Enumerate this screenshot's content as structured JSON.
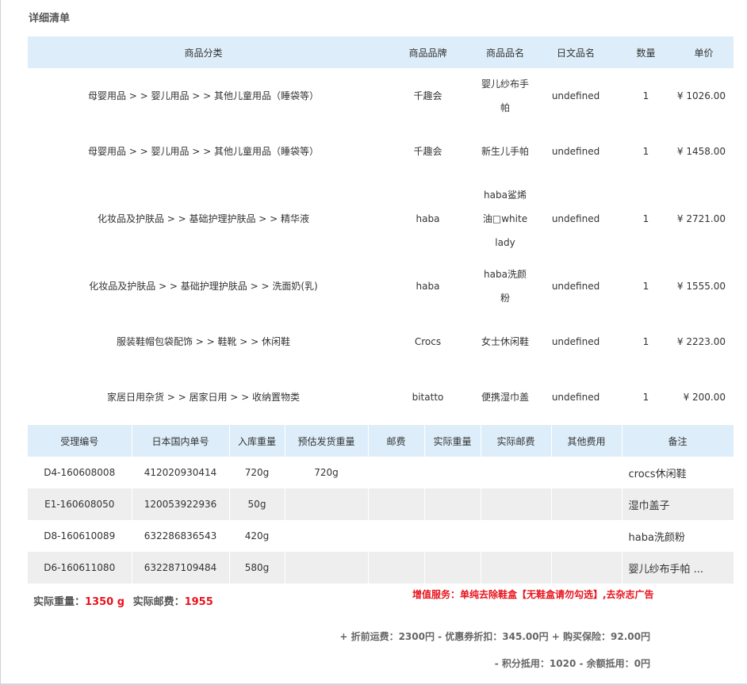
{
  "section_title": "详细清单",
  "detail_table": {
    "headers": [
      "商品分类",
      "商品品牌",
      "商品品名",
      "日文品名",
      "数量",
      "单价"
    ],
    "rows": [
      {
        "category": "母婴用品 > > 婴儿用品 > > 其他儿童用品（睡袋等）",
        "brand": "千趣会",
        "name": "婴儿纱布手帕",
        "jp_name": "undefined",
        "qty": "1",
        "price": "¥ 1026.00"
      },
      {
        "category": "母婴用品 > > 婴儿用品 > > 其他儿童用品（睡袋等）",
        "brand": "千趣会",
        "name": "新生儿手帕",
        "jp_name": "undefined",
        "qty": "1",
        "price": "¥ 1458.00"
      },
      {
        "category": "化妆品及护肤品 > > 基础护理护肤品 > > 精华液",
        "brand": "haba",
        "name": "haba鲨烯油□white lady",
        "jp_name": "undefined",
        "qty": "1",
        "price": "¥ 2721.00"
      },
      {
        "category": "化妆品及护肤品 > > 基础护理护肤品 > > 洗面奶(乳)",
        "brand": "haba",
        "name": "haba洗颜粉",
        "jp_name": "undefined",
        "qty": "1",
        "price": "¥ 1555.00"
      },
      {
        "category": "服装鞋帽包袋配饰 > > 鞋靴 > > 休闲鞋",
        "brand": "Crocs",
        "name": "女士休闲鞋",
        "jp_name": "undefined",
        "qty": "1",
        "price": "¥ 2223.00"
      },
      {
        "category": "家居日用杂货 > > 居家日用 > > 收纳置物类",
        "brand": "bitatto",
        "name": "便携湿巾盖",
        "jp_name": "undefined",
        "qty": "1",
        "price": "¥ 200.00"
      }
    ]
  },
  "receive_table": {
    "headers": [
      "受理编号",
      "日本国内单号",
      "入库重量",
      "预估发货重量",
      "邮费",
      "实际重量",
      "实际邮费",
      "其他费用",
      "备注"
    ],
    "rows": [
      {
        "id": "D4-160608008",
        "jp_no": "412020930414",
        "in_weight": "720g",
        "est_weight": "720g",
        "postage": "",
        "real_weight": "",
        "real_postage": "",
        "other": "",
        "note": "crocs休闲鞋"
      },
      {
        "id": "E1-160608050",
        "jp_no": "120053922936",
        "in_weight": "50g",
        "est_weight": "",
        "postage": "",
        "real_weight": "",
        "real_postage": "",
        "other": "",
        "note": "湿巾盖子"
      },
      {
        "id": "D8-160610089",
        "jp_no": "632286836543",
        "in_weight": "420g",
        "est_weight": "",
        "postage": "",
        "real_weight": "",
        "real_postage": "",
        "other": "",
        "note": "haba洗颜粉"
      },
      {
        "id": "D6-160611080",
        "jp_no": "632287109484",
        "in_weight": "580g",
        "est_weight": "",
        "postage": "",
        "real_weight": "",
        "real_postage": "",
        "other": "",
        "note": "婴儿纱布手帕 ..."
      }
    ]
  },
  "summary": {
    "weight_label": "实际重量：",
    "weight_value": "1350 g",
    "postage_label": "实际邮费：",
    "postage_value": "1955"
  },
  "service_note": "增值服务：单纯去除鞋盒【无鞋盒请勿勾选】,去杂志广告",
  "fee_line_1": "+ 折前运费：2300円 - 优惠券折扣：345.00円 + 购买保险：92.00円",
  "fee_line_2": "- 积分抵用：1020 - 余额抵用：0円",
  "colors": {
    "header_bg": "#ddeefa",
    "alt_row_bg": "#eeeeee",
    "accent_red": "#e8131c"
  }
}
